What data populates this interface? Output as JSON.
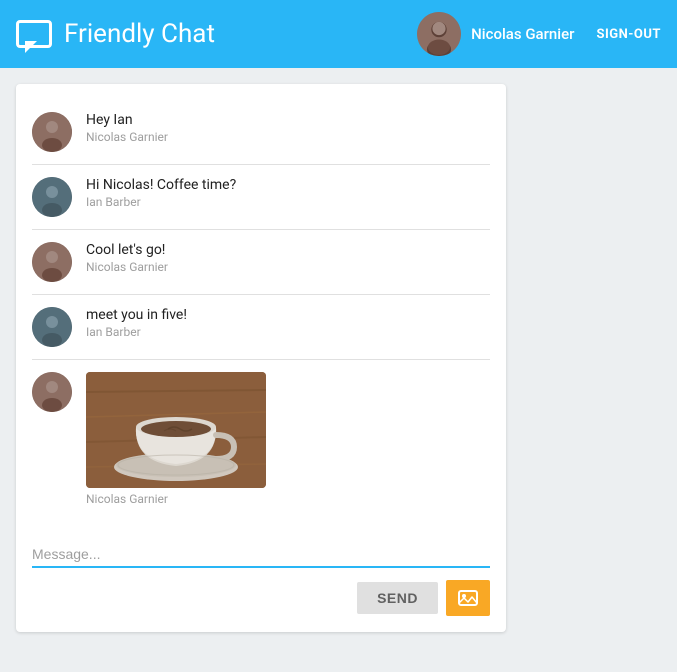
{
  "header": {
    "title": "Friendly Chat",
    "username": "Nicolas Garnier",
    "signout_label": "SIGN-OUT"
  },
  "messages": [
    {
      "id": 1,
      "text": "Hey Ian",
      "author": "Nicolas Garnier",
      "avatar_type": "nicolas",
      "has_image": false
    },
    {
      "id": 2,
      "text": "Hi Nicolas! Coffee time?",
      "author": "Ian Barber",
      "avatar_type": "ian",
      "has_image": false
    },
    {
      "id": 3,
      "text": "Cool let's go!",
      "author": "Nicolas Garnier",
      "avatar_type": "nicolas",
      "has_image": false
    },
    {
      "id": 4,
      "text": "meet you in five!",
      "author": "Ian Barber",
      "avatar_type": "ian",
      "has_image": false
    },
    {
      "id": 5,
      "text": "",
      "author": "Nicolas Garnier",
      "avatar_type": "nicolas",
      "has_image": true
    }
  ],
  "input": {
    "placeholder": "Message...",
    "value": ""
  },
  "buttons": {
    "send": "SEND"
  },
  "colors": {
    "header_bg": "#29b6f6",
    "accent": "#29b6f6",
    "image_btn": "#f9a825"
  }
}
